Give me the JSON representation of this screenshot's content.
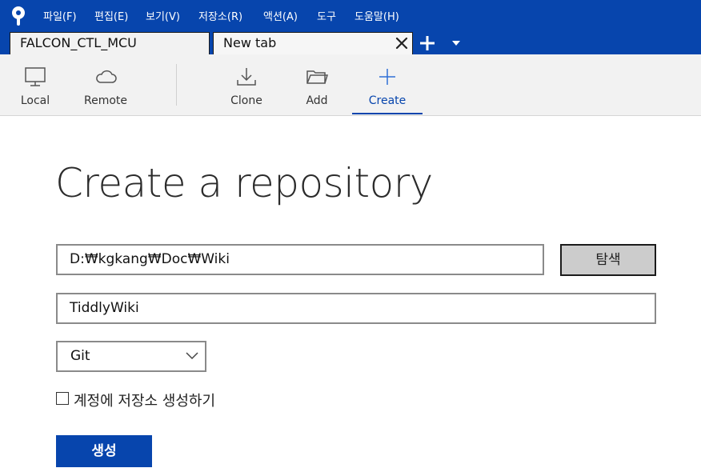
{
  "colors": {
    "brand": "#0745ad",
    "toolbar_bg": "#f2f2f2",
    "accent_icon": "#2f6fd6"
  },
  "menu": {
    "logo_icon": "sourcetree-logo-icon",
    "items": [
      {
        "label": "파일(F)"
      },
      {
        "label": "편집(E)"
      },
      {
        "label": "보기(V)"
      },
      {
        "label": "저장소(R)"
      },
      {
        "label": "액션(A)"
      },
      {
        "label": "도구"
      },
      {
        "label": "도움말(H)"
      }
    ]
  },
  "tabs": [
    {
      "label": "FALCON_CTL_MCU"
    },
    {
      "label": "New tab"
    }
  ],
  "toolbar": {
    "items": [
      {
        "label": "Local",
        "icon": "monitor-icon"
      },
      {
        "label": "Remote",
        "icon": "cloud-icon"
      },
      {
        "label": "Clone",
        "icon": "download-icon"
      },
      {
        "label": "Add",
        "icon": "folder-icon"
      },
      {
        "label": "Create",
        "icon": "plus-icon"
      }
    ],
    "active": "Create"
  },
  "main": {
    "title": "Create a repository",
    "path_value": "D:₩kgkang₩Doc₩Wiki",
    "browse_label": "탐색",
    "name_value": "TiddlyWiki",
    "repo_type_selected": "Git",
    "create_account_repo_label": "계정에 저장소 생성하기",
    "create_account_repo_checked": false,
    "create_button_label": "생성"
  }
}
